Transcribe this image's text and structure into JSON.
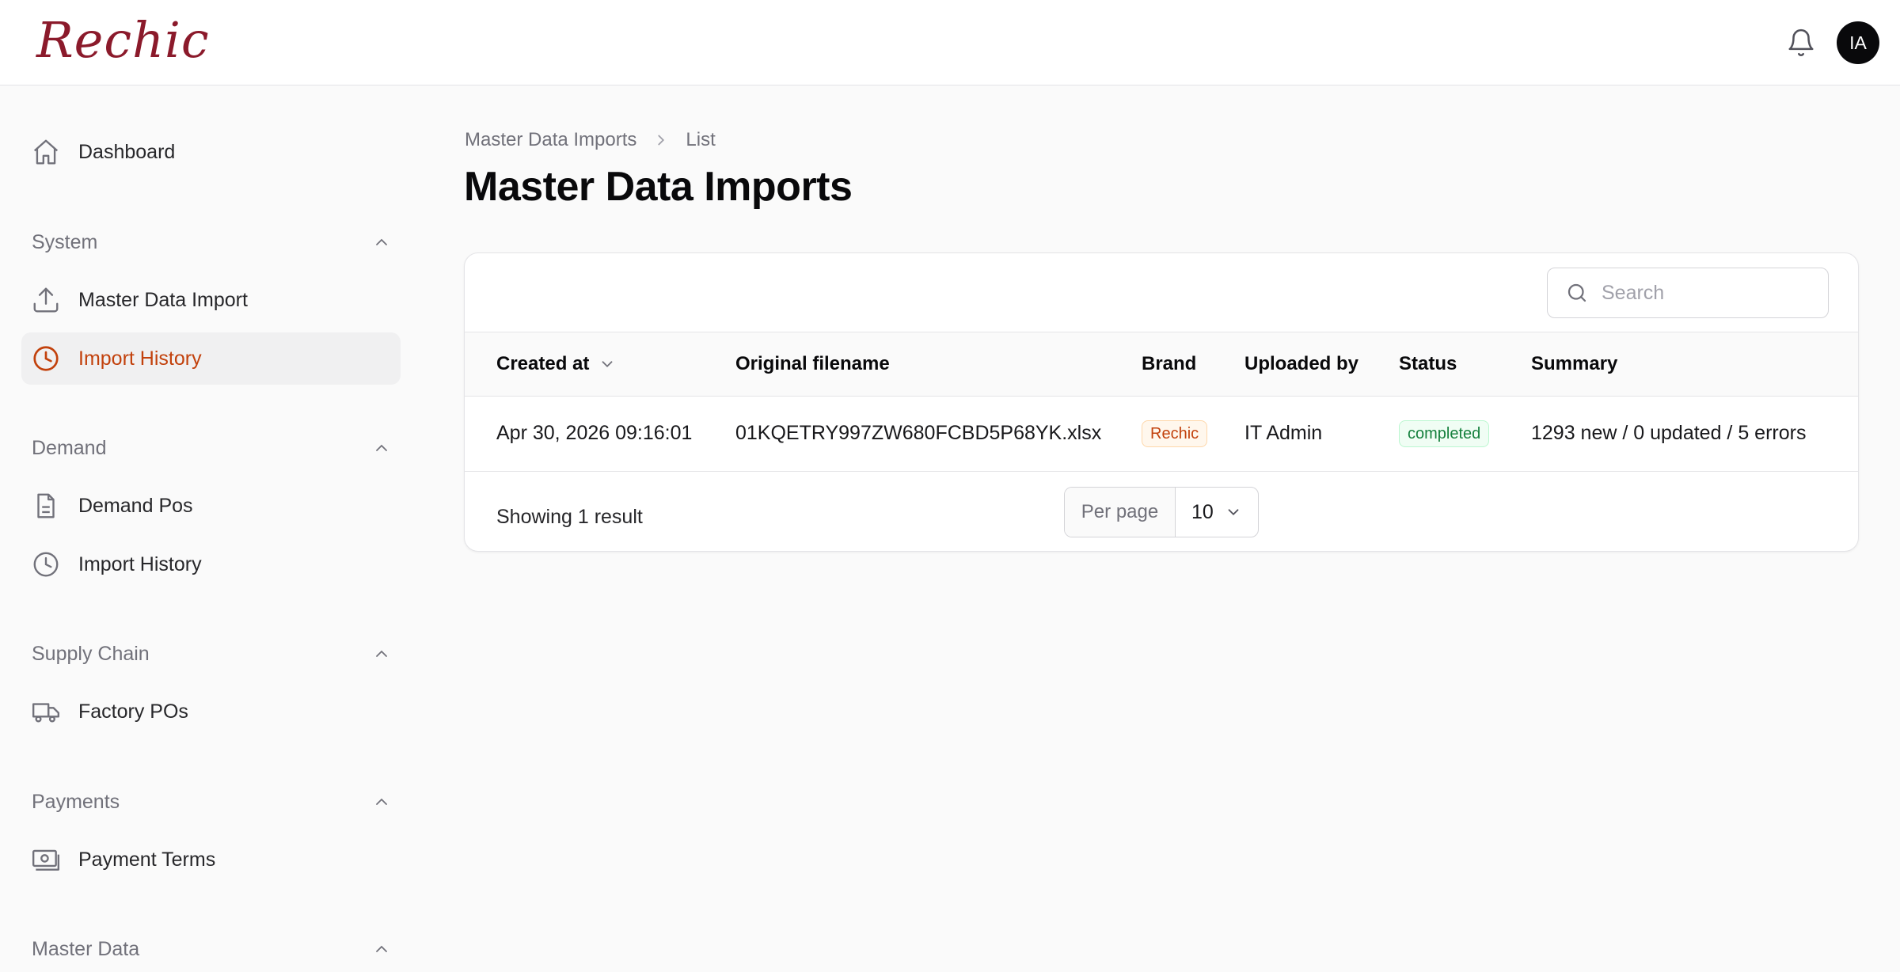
{
  "app": {
    "logo_text": "Rechic",
    "user_initials": "IA"
  },
  "sidebar": {
    "dashboard": {
      "label": "Dashboard",
      "icon": "home-icon"
    },
    "groups": [
      {
        "label": "System",
        "items": [
          {
            "label": "Master Data Import",
            "icon": "upload-icon"
          },
          {
            "label": "Import History",
            "icon": "clock-icon",
            "active": true
          }
        ]
      },
      {
        "label": "Demand",
        "items": [
          {
            "label": "Demand Pos",
            "icon": "document-icon"
          },
          {
            "label": "Import History",
            "icon": "clock-icon"
          }
        ]
      },
      {
        "label": "Supply Chain",
        "items": [
          {
            "label": "Factory POs",
            "icon": "truck-icon"
          }
        ]
      },
      {
        "label": "Payments",
        "items": [
          {
            "label": "Payment Terms",
            "icon": "cash-icon"
          }
        ]
      },
      {
        "label": "Master Data",
        "items": []
      }
    ]
  },
  "breadcrumb": {
    "items": [
      "Master Data Imports",
      "List"
    ]
  },
  "page": {
    "title": "Master Data Imports"
  },
  "table": {
    "search_placeholder": "Search",
    "columns": [
      "Created at",
      "Original filename",
      "Brand",
      "Uploaded by",
      "Status",
      "Summary"
    ],
    "rows": [
      {
        "created_at": "Apr 30, 2026 09:16:01",
        "filename": "01KQETRY997ZW680FCBD5P68YK.xlsx",
        "brand": "Rechic",
        "uploaded_by": "IT Admin",
        "status": "completed",
        "summary": "1293 new / 0 updated / 5 errors"
      }
    ],
    "footer": {
      "result_text": "Showing 1 result",
      "per_page_label": "Per page",
      "per_page_value": "10"
    }
  },
  "colors": {
    "accent": "#c2410c",
    "brand": "#8b1a2b",
    "success": "#15803d"
  }
}
